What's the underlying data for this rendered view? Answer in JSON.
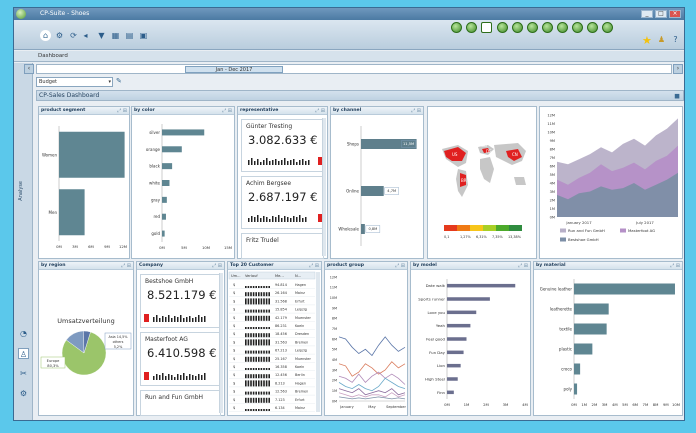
{
  "window": {
    "title": "CP-Suite - Shoes",
    "buttons": [
      "_",
      "□",
      "×"
    ]
  },
  "toolbar": {
    "left_icons": [
      "home-icon",
      "settings-icon",
      "filter-icon",
      "grid-icon",
      "table-icon"
    ],
    "right_icons": [
      "refresh-icon",
      "chart-icon",
      "chart-icon",
      "chart-icon",
      "chart-icon",
      "chart-icon",
      "chart-icon",
      "chart-icon",
      "chart-icon",
      "chart-icon"
    ],
    "fav_icons": [
      "star-icon",
      "user-icon",
      "help-icon"
    ]
  },
  "breadcrumb": "Dashboard",
  "timeline": {
    "range": "Jan - Dec 2017"
  },
  "scenario": {
    "value": "Budget"
  },
  "dashboard_title": "CP-Sales Dashboard",
  "sidebar": {
    "label": "Analyse"
  },
  "panels": {
    "product_segment": {
      "title": "product segment",
      "categories": [
        "Women",
        "Men"
      ],
      "values": [
        12.3,
        4.8
      ],
      "ticks": [
        "0M",
        "3M",
        "6M",
        "9M",
        "12M"
      ]
    },
    "by_color": {
      "title": "by color",
      "categories": [
        "silver",
        "orange",
        "black",
        "white",
        "gray",
        "red",
        "gold"
      ],
      "values": [
        9.6,
        4.5,
        2.3,
        1.7,
        1.1,
        0.9,
        0.6
      ],
      "ticks": [
        "0M",
        "5M",
        "10M",
        "15M"
      ]
    },
    "representative": {
      "title": "representative",
      "items": [
        {
          "name": "Günter Tresting",
          "value": "3.082.633 €"
        },
        {
          "name": "Achim Bergsee",
          "value": "2.687.197 €"
        },
        {
          "name": "Fritz Trudel",
          "value": ""
        }
      ]
    },
    "by_channel": {
      "title": "by channel",
      "categories": [
        "Shops",
        "Online",
        "Wholesale"
      ],
      "values": [
        11.5,
        4.7,
        0.8
      ],
      "labels": [
        "11,5M",
        "4,7M",
        "0,8M"
      ]
    },
    "map": {
      "country_labels": [
        "US",
        "GB",
        "DE",
        "CN",
        "BR"
      ],
      "legend_colors": [
        "#e53a1d",
        "#ef7a14",
        "#f7c51a",
        "#a8cf26",
        "#4caa2b",
        "#2f8c3f"
      ],
      "legend_ticks": [
        "0,1",
        "1,27%",
        "6,31%",
        "7,35%",
        "13,38%"
      ]
    },
    "area_chart": {
      "y_ticks": [
        "0M",
        "1M",
        "2M",
        "3M",
        "4M",
        "5M",
        "6M",
        "7M",
        "8M",
        "9M",
        "10M",
        "11M",
        "12M"
      ],
      "x_ticks": [
        "January 2017",
        "July 2017"
      ],
      "legend": [
        "Run and Fun GmbH",
        "Masterfoot AG",
        "Bestshoe GmbH"
      ],
      "colors": [
        "#b8b0c8",
        "#b590c7",
        "#7d8fa7"
      ]
    },
    "by_region": {
      "title": "by region",
      "pie_title": "Umsatzverteilung",
      "slices": [
        {
          "name": "Europe",
          "value": 80.3,
          "label": "Europe\n80,3%",
          "color": "#9bc56a"
        },
        {
          "name": "Asia",
          "value": 14.5,
          "label": "Asia 14,5%",
          "color": "#7e9ac0"
        },
        {
          "name": "others",
          "value": 5.2,
          "label": "others\n5,2%",
          "color": "#5b76a8"
        }
      ]
    },
    "company": {
      "title": "Company",
      "items": [
        {
          "name": "Bestshoe GmbH",
          "value": "8.521.179 €"
        },
        {
          "name": "Masterfoot AG",
          "value": "6.410.598 €"
        },
        {
          "name": "Run and Fun GmbH",
          "value": ""
        }
      ]
    },
    "top20": {
      "title": "Top 20 Customer",
      "columns": [
        "Um...",
        "Verlauf",
        "Me...",
        "N..."
      ],
      "rows": [
        [
          "$",
          "",
          "94.814",
          "Hagen"
        ],
        [
          "$",
          "",
          "26.164",
          "Mainz"
        ],
        [
          "$",
          "",
          "31.568",
          "Erfurt"
        ],
        [
          "$",
          "",
          "15.854",
          "Leipzig"
        ],
        [
          "$",
          "",
          "42.179",
          "Muenster"
        ],
        [
          "$",
          "",
          "86.231",
          "Koeln"
        ],
        [
          "$",
          "",
          "18.456",
          "Dresden"
        ],
        [
          "$",
          "",
          "31.563",
          "Bremen"
        ],
        [
          "$",
          "",
          "67.213",
          "Leipzig"
        ],
        [
          "$",
          "",
          "25.167",
          "Muenster"
        ],
        [
          "$",
          "",
          "16.358",
          "Koeln"
        ],
        [
          "$",
          "",
          "12.456",
          "Berlin"
        ],
        [
          "$",
          "",
          "8.213",
          "Hagen"
        ],
        [
          "$",
          "",
          "12.563",
          "Bremen"
        ],
        [
          "$",
          "",
          "7.123",
          "Erfurt"
        ],
        [
          "$",
          "",
          "6.134",
          "Mainz"
        ]
      ]
    },
    "product_group": {
      "title": "product group",
      "y_ticks": [
        "0M",
        "1M",
        "2M",
        "3M",
        "4M",
        "5M",
        "6M",
        "7M",
        "8M",
        "9M",
        "10M",
        "11M",
        "12M"
      ],
      "x_ticks": [
        "January",
        "May",
        "September"
      ],
      "colors": [
        "#5b76a8",
        "#d97b5c",
        "#b08ab8",
        "#6aa9c9",
        "#8a6a9c",
        "#c9a0c2",
        "#7d8fa7"
      ]
    },
    "by_model": {
      "title": "by model",
      "categories": [
        "Date walk",
        "Sports runner",
        "Love you",
        "Yeah",
        "Feel good",
        "Fun Day",
        "Lion",
        "High Steel",
        "Finn"
      ],
      "values": [
        3.5,
        2.2,
        1.5,
        1.2,
        1.0,
        0.85,
        0.7,
        0.55,
        0.35
      ],
      "ticks": [
        "0M",
        "1M",
        "2M",
        "3M",
        "4M"
      ]
    },
    "by_material": {
      "title": "by material",
      "categories": [
        "Genuine leather",
        "leatherette",
        "textile",
        "plastic",
        "croco",
        "poly"
      ],
      "values": [
        9.9,
        3.4,
        3.2,
        1.8,
        0.6,
        0.3
      ],
      "ticks": [
        "0M",
        "1M",
        "2M",
        "3M",
        "4M",
        "5M",
        "6M",
        "7M",
        "8M",
        "9M",
        "10M"
      ]
    }
  },
  "colors": {
    "bar": "#5f8692",
    "accent": "#3a6b93",
    "kpi_square": "#e02020"
  }
}
